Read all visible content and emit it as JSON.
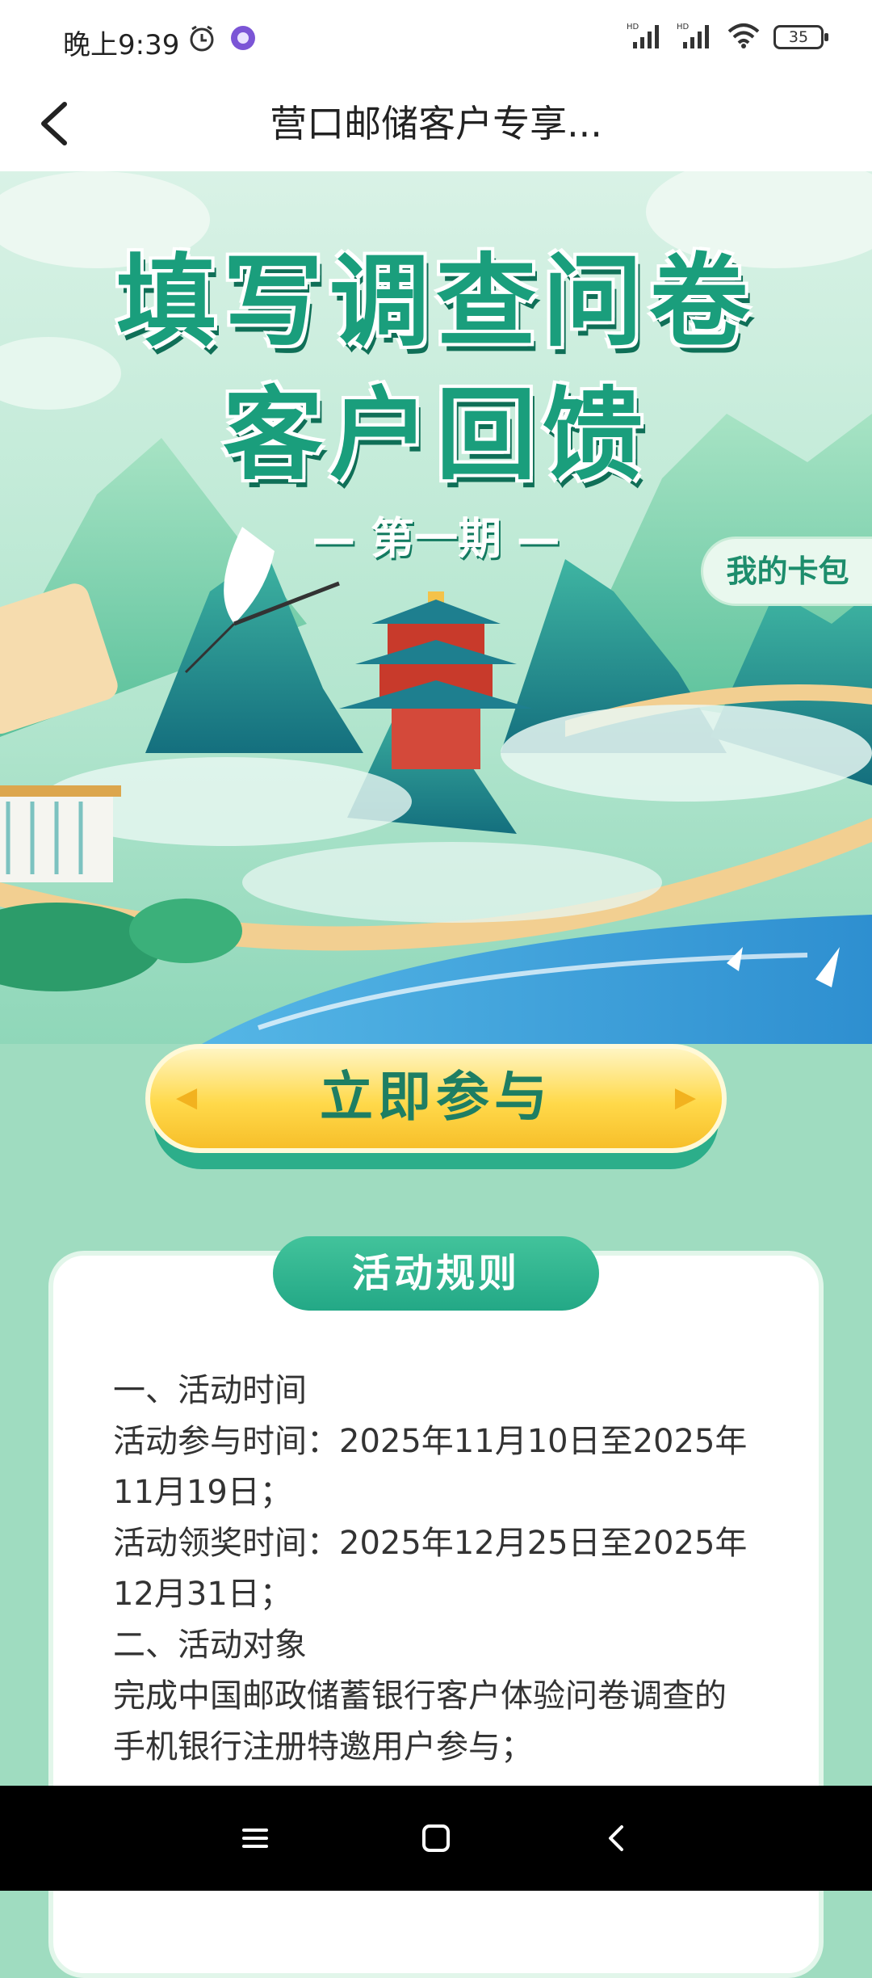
{
  "status_bar": {
    "time": "晚上9:39",
    "battery": "35",
    "icons": [
      "alarm-icon",
      "app-notification-icon",
      "hd-signal-icon",
      "hd-signal-icon",
      "wifi-icon",
      "battery-icon"
    ]
  },
  "header": {
    "title": "营口邮储客户专享...",
    "back_icon": "chevron-left-icon"
  },
  "hero": {
    "title_line1": "填写调查问卷",
    "title_line2": "客户回馈",
    "issue": "— 第一期 —",
    "wallet_label": "我的卡包"
  },
  "join_button": {
    "label": "立即参与"
  },
  "rules": {
    "tab_label": "活动规则",
    "lines": [
      "一、活动时间",
      "活动参与时间：2025年11月10日至2025年",
      "11月19日；",
      "活动领奖时间：2025年12月25日至2025年",
      "12月31日；",
      "二、活动对象",
      "完成中国邮政储蓄银行客户体验问卷调查的",
      "手机银行注册特邀用户参与；"
    ]
  },
  "nav_bar": {
    "icons": [
      "menu-icon",
      "home-square-icon",
      "back-triangle-icon"
    ]
  },
  "colors": {
    "accent_green": "#1a9e7c",
    "button_yellow": "#ffd94a",
    "page_bg": "#9fdcc0"
  }
}
